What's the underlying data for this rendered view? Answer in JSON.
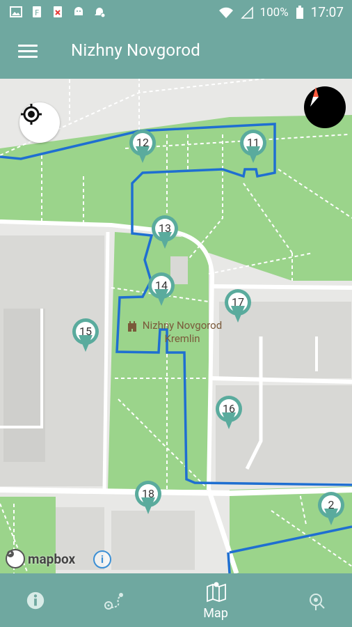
{
  "status_bar": {
    "battery_percent": "100%",
    "time": "17:07"
  },
  "app_bar": {
    "title": "Nizhny Novgorod",
    "menu_icon": "menu-icon"
  },
  "map": {
    "landmark_label_line1": "Nizhny Novgorod",
    "landmark_label_line2": "Kremlin",
    "attribution": "mapbox",
    "attribution_info": "i",
    "route_color": "#1f6fd1",
    "pin_color": "#5aab9d",
    "park_color": "#9bd48b",
    "pins": [
      "12",
      "11",
      "13",
      "14",
      "17",
      "15",
      "16",
      "18",
      "2"
    ]
  },
  "bottom_nav": {
    "items": [
      {
        "label": "",
        "icon": "info-icon"
      },
      {
        "label": "",
        "icon": "route-icon"
      },
      {
        "label": "Map",
        "icon": "map-icon",
        "active": true
      },
      {
        "label": "",
        "icon": "places-icon"
      }
    ]
  },
  "colors": {
    "primary": "#6fa8a0"
  }
}
